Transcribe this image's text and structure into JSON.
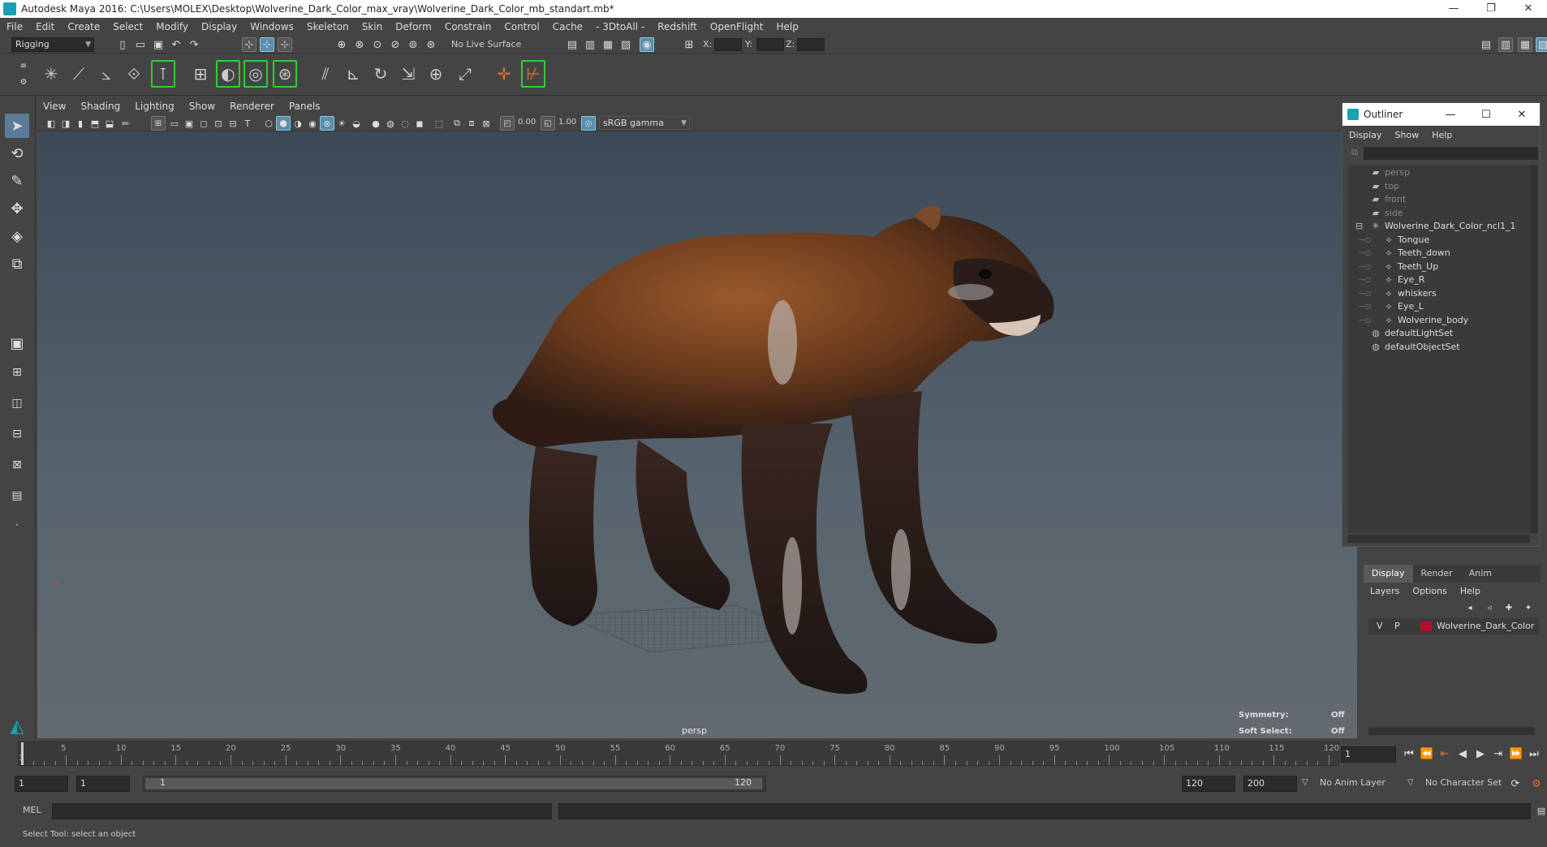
{
  "window": {
    "title": "Autodesk Maya 2016: C:\\Users\\MOLEX\\Desktop\\Wolverine_Dark_Color_max_vray\\Wolverine_Dark_Color_mb_standart.mb*",
    "minimize": "—",
    "restore": "❐",
    "close": "✕"
  },
  "menubar": [
    "File",
    "Edit",
    "Create",
    "Select",
    "Modify",
    "Display",
    "Windows",
    "Skeleton",
    "Skin",
    "Deform",
    "Constrain",
    "Control",
    "Cache",
    "- 3DtoAll -",
    "Redshift",
    "OpenFlight",
    "Help"
  ],
  "statusline": {
    "mode": "Rigging",
    "live_surface": "No Live Surface",
    "x_label": "X:",
    "y_label": "Y:",
    "z_label": "Z:"
  },
  "panel": {
    "menus": [
      "View",
      "Shading",
      "Lighting",
      "Show",
      "Renderer",
      "Panels"
    ],
    "exposure": "0.00",
    "gamma": "1.00",
    "colorspace": "sRGB gamma"
  },
  "viewport": {
    "camera": "persp",
    "symmetry_label": "Symmetry:",
    "symmetry_value": "Off",
    "soft_select_label": "Soft Select:",
    "soft_select_value": "Off"
  },
  "outliner": {
    "title": "Outliner",
    "menus": [
      "Display",
      "Show",
      "Help"
    ],
    "items": [
      {
        "label": "persp",
        "icon": "camera-icon"
      },
      {
        "label": "top",
        "icon": "camera-icon"
      },
      {
        "label": "front",
        "icon": "camera-icon"
      },
      {
        "label": "side",
        "icon": "camera-icon"
      },
      {
        "label": "Wolverine_Dark_Color_ncl1_1",
        "icon": "group-icon"
      },
      {
        "label": "Tongue",
        "icon": "mesh-icon"
      },
      {
        "label": "Teeth_down",
        "icon": "mesh-icon"
      },
      {
        "label": "Teeth_Up",
        "icon": "mesh-icon"
      },
      {
        "label": "Eye_R",
        "icon": "mesh-icon"
      },
      {
        "label": "whiskers",
        "icon": "mesh-icon"
      },
      {
        "label": "Eye_L",
        "icon": "mesh-icon"
      },
      {
        "label": "Wolverine_body",
        "icon": "mesh-icon"
      },
      {
        "label": "defaultLightSet",
        "icon": "set-icon"
      },
      {
        "label": "defaultObjectSet",
        "icon": "set-icon"
      }
    ]
  },
  "layers": {
    "tabs": [
      "Display",
      "Render",
      "Anim"
    ],
    "menus": [
      "Layers",
      "Options",
      "Help"
    ],
    "row": {
      "v": "V",
      "p": "P",
      "name": "Wolverine_Dark_Color",
      "color": "#b0102a"
    }
  },
  "timeline": {
    "ticks": [
      "1",
      "5",
      "10",
      "15",
      "20",
      "25",
      "30",
      "35",
      "40",
      "45",
      "50",
      "55",
      "60",
      "65",
      "70",
      "75",
      "80",
      "85",
      "90",
      "95",
      "100",
      "105",
      "110",
      "115",
      "120"
    ],
    "current_frame": "1"
  },
  "range": {
    "start": "1",
    "playback_start": "1",
    "slider_start": "1",
    "slider_end": "120",
    "playback_end": "120",
    "end": "200",
    "anim_layer": "No Anim Layer",
    "character_set": "No Character Set"
  },
  "command": {
    "lang": "MEL"
  },
  "help_line": "Select Tool: select an object"
}
